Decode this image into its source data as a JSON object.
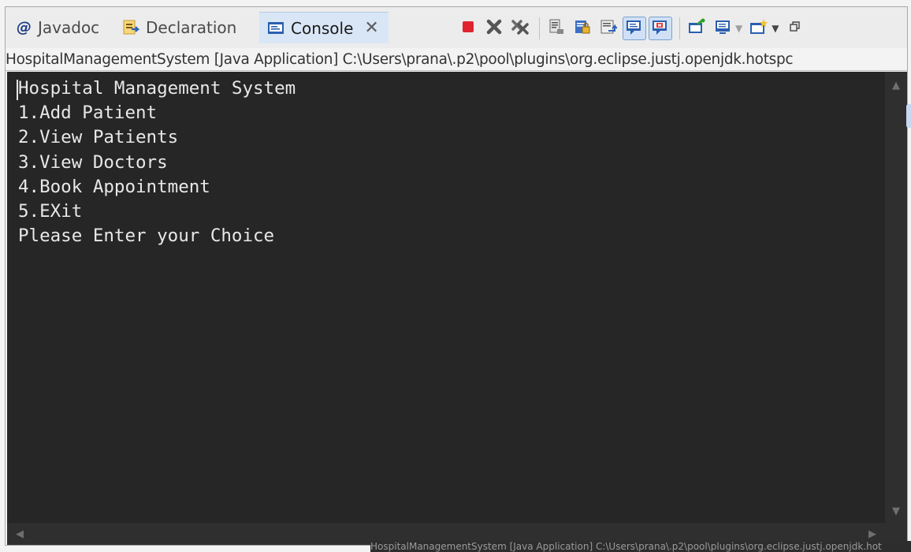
{
  "tabs": [
    {
      "label": "Javadoc",
      "icon": "at-icon"
    },
    {
      "label": "Declaration",
      "icon": "declaration-icon"
    },
    {
      "label": "Console",
      "icon": "console-icon",
      "active": true
    }
  ],
  "toolbar": {
    "icons": [
      "terminate-icon",
      "remove-launch-icon",
      "remove-all-terminated-icon",
      "clear-console-icon",
      "scroll-lock-icon",
      "word-wrap-icon",
      "show-on-stdout-icon",
      "show-on-stderr-icon",
      "pin-console-icon",
      "display-console-icon",
      "open-console-icon",
      "restore-icon"
    ]
  },
  "process_label": "HospitalManagementSystem [Java Application] C:\\Users\\prana\\.p2\\pool\\plugins\\org.eclipse.justj.openjdk.hotspc",
  "console_lines": [
    "Hospital Management System",
    "1.Add Patient",
    "2.View Patients",
    "3.View Doctors",
    "4.Book Appointment",
    "5.EXit",
    "Please Enter your Choice"
  ],
  "status_ghost": "HospitalManagementSystem [Java Application] C:\\Users\\prana\\.p2\\pool\\plugins\\org.eclipse.justj.openjdk.hot",
  "colors": {
    "console_bg": "#262626",
    "console_text": "#e8e8e8",
    "active_tab": "#d9e6f6",
    "terminate_red": "#e0242f"
  }
}
